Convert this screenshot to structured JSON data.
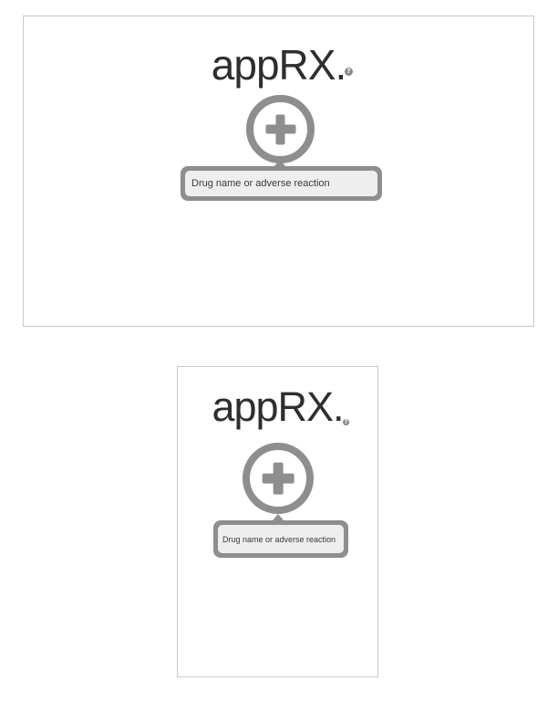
{
  "app": {
    "logo_text": "appRX",
    "logo_dot": ".",
    "help_icon": "question-mark-icon",
    "help_glyph": "?"
  },
  "add_button": {
    "icon": "plus-icon"
  },
  "search": {
    "placeholder": "Drug name or adverse reaction"
  },
  "layouts": [
    "landscape",
    "portrait"
  ]
}
